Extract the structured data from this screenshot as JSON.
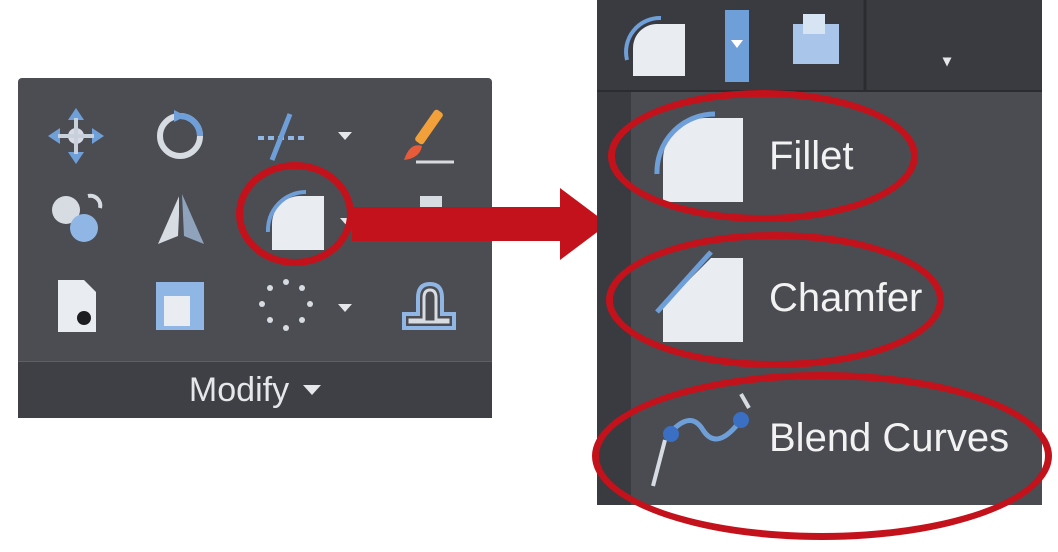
{
  "modify_panel": {
    "title": "Modify",
    "tools": [
      {
        "icon": "move-icon"
      },
      {
        "icon": "rotate-icon"
      },
      {
        "icon": "trim-extend-icon"
      },
      {
        "icon": "properties-brush-icon"
      },
      {
        "icon": "copy-icon"
      },
      {
        "icon": "mirror-icon"
      },
      {
        "icon": "fillet-icon"
      },
      {
        "icon": "stretch-icon"
      },
      {
        "icon": "erase-icon"
      },
      {
        "icon": "scale-icon"
      },
      {
        "icon": "array-icon"
      },
      {
        "icon": "offset-icon"
      }
    ]
  },
  "dropdown": {
    "items": [
      {
        "label": "Fillet",
        "icon": "fillet-icon"
      },
      {
        "label": "Chamfer",
        "icon": "chamfer-icon"
      },
      {
        "label": "Blend Curves",
        "icon": "blend-curves-icon"
      }
    ]
  },
  "colors": {
    "highlight": "#c3121b",
    "panel_bg": "#4b4d52",
    "text": "#f2f2f2"
  }
}
